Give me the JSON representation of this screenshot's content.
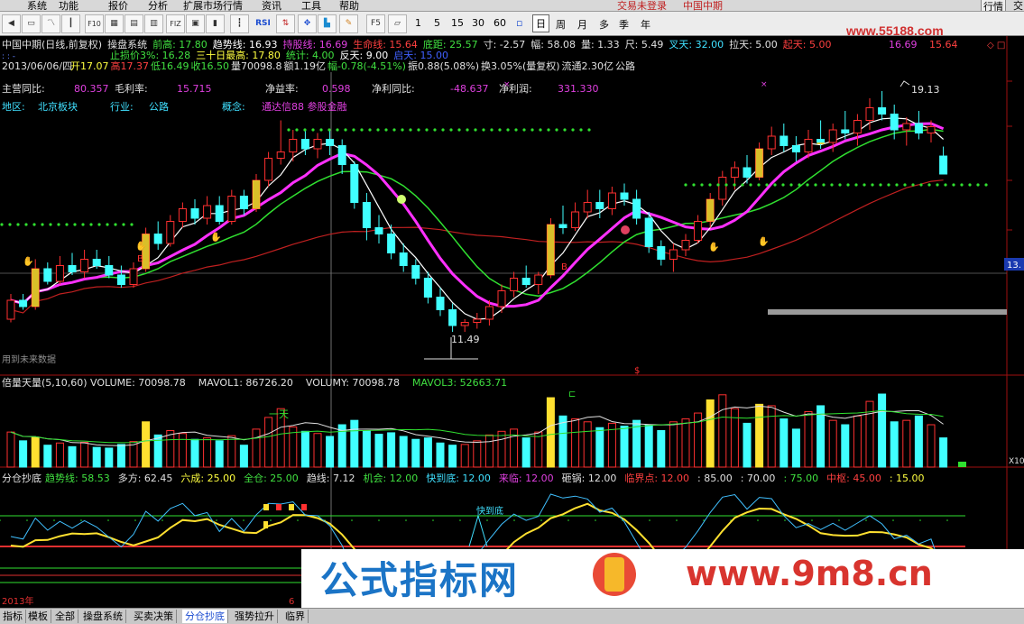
{
  "menu": {
    "items": [
      "系统",
      "功能",
      "报价",
      "分析",
      "扩展市场行情",
      "资讯",
      "工具",
      "帮助"
    ],
    "login_status": "交易未登录",
    "stock_label": "中国中期",
    "right_items": [
      "行情",
      "交"
    ]
  },
  "toolbar": {
    "periods": [
      "1",
      "5",
      "15",
      "30",
      "60"
    ],
    "periods_cn": [
      "日",
      "周",
      "月",
      "多",
      "季",
      "年"
    ],
    "icons": [
      "arrow-left-icon",
      "monitor-icon",
      "line-chart-icon",
      "candle-icon",
      "f10-icon",
      "table-icon",
      "grid-icon",
      "fiz-icon",
      "calc-icon",
      "chart-icon",
      "rsi-icon",
      "arrows-icon",
      "move-icon",
      "bars-icon",
      "pencil-icon",
      "f5-icon",
      "tool-icon"
    ],
    "rsi_label": "RSI",
    "f5_label": "F5",
    "site_banner": "www.55188.com"
  },
  "info": {
    "line1": [
      {
        "t": "中国中期(日线,前复权)",
        "c": "#e0e0e0"
      },
      {
        "t": "操盘系统",
        "c": "#e0e0e0"
      },
      {
        "t": "前高: 17.80",
        "c": "#40e040"
      },
      {
        "t": "趋势线: 16.93",
        "c": "#ffffff"
      },
      {
        "t": "持股线: 16.69",
        "c": "#e040e0"
      },
      {
        "t": "生命线: 15.64",
        "c": "#ff4040"
      },
      {
        "t": "底距: 25.57",
        "c": "#40e040"
      },
      {
        "t": "寸: -2.57",
        "c": "#e0e0e0"
      },
      {
        "t": "幅: 58.08",
        "c": "#e0e0e0"
      },
      {
        "t": "量: 1.33",
        "c": "#e0e0e0"
      },
      {
        "t": "尺: 5.49",
        "c": "#e0e0e0"
      },
      {
        "t": "叉天: 32.00",
        "c": "#40e0ff"
      },
      {
        "t": "拉天: 5.00",
        "c": "#e0e0e0"
      },
      {
        "t": "起天: 5.00",
        "c": "#ff4040"
      }
    ],
    "line1_right": [
      {
        "t": "16.69",
        "c": "#e040e0"
      },
      {
        "t": "15.64",
        "c": "#ff4040"
      }
    ],
    "line2": [
      {
        "t": "止损价3%: 16.28",
        "c": "#40e040"
      },
      {
        "t": "三十日最高: 17.80",
        "c": "#ffff40"
      },
      {
        "t": "统计: 4.00",
        "c": "#40e040"
      },
      {
        "t": "反天: 9.00",
        "c": "#ffffff"
      },
      {
        "t": "启天: 15.00",
        "c": "#4060ff"
      }
    ],
    "line3": "2013/06/06/四",
    "line3_items": [
      {
        "t": "开17.07",
        "c": "#ffff40"
      },
      {
        "t": "高17.37",
        "c": "#ff4040"
      },
      {
        "t": "低16.49",
        "c": "#40e040"
      },
      {
        "t": "收16.50",
        "c": "#40e040"
      },
      {
        "t": "量70098.8",
        "c": "#e0e0e0"
      },
      {
        "t": "额1.19亿",
        "c": "#e0e0e0"
      },
      {
        "t": "幅-0.78(-4.51%)",
        "c": "#40e040"
      },
      {
        "t": "振0.88(5.08%)",
        "c": "#e0e0e0"
      },
      {
        "t": "换3.05%(量复权)",
        "c": "#e0e0e0"
      },
      {
        "t": "流通2.30亿",
        "c": "#e0e0e0"
      },
      {
        "t": "公路",
        "c": "#e0e0e0"
      }
    ]
  },
  "fundamentals": {
    "items": [
      {
        "label": "主营同比:",
        "value": "80.357"
      },
      {
        "label": "毛利率:",
        "value": "15.715"
      },
      {
        "label": "净益率:",
        "value": "0.598"
      },
      {
        "label": "净利同比:",
        "value": "-48.637"
      },
      {
        "label": "净利润:",
        "value": "331.330"
      }
    ],
    "region_label": "地区:",
    "region": "北京板块",
    "industry_label": "行业:",
    "industry": "公路",
    "concept_label": "概念:",
    "concept": "通达信88  参股金融"
  },
  "main_chart": {
    "peak_label": "19.13",
    "low_label": "11.49",
    "right_price": "13.",
    "future_note": "用到未来数据",
    "buy_marker": "B",
    "sell_marker": "$",
    "colors": {
      "up": "#ff3030",
      "down": "#40ffff",
      "white": "#ffffff",
      "magenta": "#ff30ff",
      "green": "#30e030",
      "lifeline": "#c02020",
      "yellow": "#ffe030"
    }
  },
  "volume_panel": {
    "title": "倍量天量(5,10,60)",
    "items": [
      {
        "t": "VOLUME: 70098.78",
        "c": "#e0e0e0"
      },
      {
        "t": "MAVOL1: 86726.20",
        "c": "#e0e0e0"
      },
      {
        "t": "VOLUMY: 70098.78",
        "c": "#e0e0e0"
      },
      {
        "t": "MAVOL3: 52663.71",
        "c": "#40e040"
      }
    ],
    "sky_label": "一天",
    "right_tag": "X10"
  },
  "indicator_panel": {
    "title": "分仓抄底",
    "items": [
      {
        "t": "趋势线: 58.53",
        "c": "#40e040"
      },
      {
        "t": "多方: 62.45",
        "c": "#e0e0e0"
      },
      {
        "t": "六成: 25.00",
        "c": "#ffff40"
      },
      {
        "t": "全仓: 25.00",
        "c": "#40e040"
      },
      {
        "t": "趋线: 7.12",
        "c": "#e0e0e0"
      },
      {
        "t": "机会: 12.00",
        "c": "#40e040"
      },
      {
        "t": "快到底: 12.00",
        "c": "#40e0ff"
      },
      {
        "t": "来临: 12.00",
        "c": "#e040e0"
      },
      {
        "t": "砸锅: 12.00",
        "c": "#e0e0e0"
      },
      {
        "t": "临界点: 12.00",
        "c": "#ff4040"
      },
      {
        "t": ": 85.00",
        "c": "#e0e0e0"
      },
      {
        "t": ": 70.00",
        "c": "#e0e0e0"
      },
      {
        "t": ": 75.00",
        "c": "#40e040"
      },
      {
        "t": "中枢: 45.00",
        "c": "#ff4040"
      },
      {
        "t": ": 15.00",
        "c": "#ffff40"
      }
    ],
    "fast_bottom_label": "快到底",
    "year_label": "2013年",
    "month_label": "6"
  },
  "bottom_tabs": [
    "指标",
    "模板",
    "全部",
    "操盘系统",
    "买卖决策",
    "分仓抄底",
    "强势拉升",
    "临界"
  ],
  "active_tab": "分仓抄底",
  "watermark": {
    "left": "公式指标网",
    "right": "www.9m8.cn"
  },
  "candles": [
    [
      11.9,
      12.7,
      11.8,
      12.5
    ],
    [
      12.5,
      12.7,
      12.2,
      12.3
    ],
    [
      12.3,
      13.8,
      12.2,
      13.5
    ],
    [
      13.5,
      13.7,
      13.0,
      13.1
    ],
    [
      13.1,
      13.9,
      13.0,
      13.6
    ],
    [
      13.6,
      14.0,
      13.3,
      13.4
    ],
    [
      13.4,
      14.1,
      13.2,
      13.8
    ],
    [
      13.8,
      14.1,
      13.5,
      13.6
    ],
    [
      13.6,
      13.9,
      13.2,
      13.3
    ],
    [
      13.3,
      13.6,
      12.9,
      13.0
    ],
    [
      13.0,
      13.7,
      12.9,
      13.5
    ],
    [
      13.5,
      14.8,
      13.4,
      14.6
    ],
    [
      14.6,
      15.0,
      14.1,
      14.3
    ],
    [
      14.3,
      15.2,
      14.2,
      15.0
    ],
    [
      15.0,
      15.6,
      14.8,
      15.4
    ],
    [
      15.4,
      15.7,
      14.9,
      15.1
    ],
    [
      15.1,
      15.8,
      14.9,
      15.5
    ],
    [
      15.5,
      15.8,
      14.9,
      15.0
    ],
    [
      15.0,
      16.0,
      14.9,
      15.8
    ],
    [
      15.8,
      16.0,
      15.2,
      15.4
    ],
    [
      15.4,
      16.5,
      15.3,
      16.3
    ],
    [
      16.3,
      17.2,
      16.1,
      17.0
    ],
    [
      17.0,
      18.2,
      16.8,
      17.2
    ],
    [
      17.2,
      17.9,
      16.9,
      17.6
    ],
    [
      17.6,
      17.9,
      17.1,
      17.3
    ],
    [
      17.3,
      17.8,
      17.0,
      17.6
    ],
    [
      17.6,
      17.9,
      17.1,
      17.4
    ],
    [
      17.4,
      17.6,
      16.5,
      16.8
    ],
    [
      16.8,
      16.9,
      15.4,
      15.6
    ],
    [
      15.6,
      15.9,
      14.4,
      14.8
    ],
    [
      14.8,
      15.2,
      14.3,
      14.6
    ],
    [
      14.6,
      14.9,
      13.8,
      14.0
    ],
    [
      14.0,
      14.3,
      13.4,
      13.6
    ],
    [
      13.6,
      13.8,
      13.0,
      13.2
    ],
    [
      13.2,
      13.4,
      12.4,
      12.6
    ],
    [
      12.6,
      12.9,
      12.0,
      12.2
    ],
    [
      12.2,
      12.4,
      11.5,
      11.7
    ],
    [
      11.7,
      11.9,
      11.5,
      11.8
    ],
    [
      11.8,
      12.1,
      11.6,
      11.9
    ],
    [
      11.9,
      12.5,
      11.7,
      12.3
    ],
    [
      12.3,
      13.0,
      12.1,
      12.8
    ],
    [
      12.8,
      13.4,
      12.6,
      13.2
    ],
    [
      13.2,
      13.6,
      12.9,
      13.0
    ],
    [
      13.0,
      13.4,
      12.7,
      13.3
    ],
    [
      13.3,
      15.1,
      13.2,
      14.9
    ],
    [
      14.9,
      15.5,
      14.6,
      14.8
    ],
    [
      14.8,
      15.6,
      14.7,
      15.3
    ],
    [
      15.3,
      16.0,
      15.1,
      15.6
    ],
    [
      15.6,
      16.0,
      15.1,
      15.4
    ],
    [
      15.4,
      16.1,
      15.2,
      15.9
    ],
    [
      15.9,
      16.2,
      15.5,
      15.7
    ],
    [
      15.7,
      16.0,
      14.9,
      15.1
    ],
    [
      15.1,
      15.3,
      14.0,
      14.2
    ],
    [
      14.2,
      14.4,
      13.6,
      13.8
    ],
    [
      13.8,
      14.3,
      13.4,
      14.1
    ],
    [
      14.1,
      14.6,
      13.9,
      14.4
    ],
    [
      14.4,
      15.2,
      14.3,
      15.0
    ],
    [
      15.0,
      15.9,
      14.8,
      15.7
    ],
    [
      15.7,
      16.6,
      15.5,
      16.4
    ],
    [
      16.4,
      16.9,
      16.0,
      16.7
    ],
    [
      16.7,
      17.1,
      16.2,
      16.4
    ],
    [
      16.4,
      17.5,
      16.3,
      17.3
    ],
    [
      17.3,
      18.0,
      17.1,
      17.7
    ],
    [
      17.7,
      18.1,
      17.2,
      17.4
    ],
    [
      17.4,
      17.7,
      16.9,
      17.2
    ],
    [
      17.2,
      17.9,
      17.0,
      17.6
    ],
    [
      17.6,
      18.2,
      17.3,
      17.5
    ],
    [
      17.5,
      18.1,
      17.2,
      17.9
    ],
    [
      17.9,
      18.5,
      17.6,
      17.8
    ],
    [
      17.8,
      18.4,
      17.4,
      18.2
    ],
    [
      18.2,
      18.9,
      17.9,
      18.6
    ],
    [
      18.6,
      19.13,
      18.2,
      18.4
    ],
    [
      18.4,
      18.7,
      17.6,
      17.9
    ],
    [
      17.9,
      18.3,
      17.4,
      18.1
    ],
    [
      18.1,
      18.5,
      17.6,
      17.8
    ],
    [
      17.8,
      18.2,
      17.5,
      18.0
    ],
    [
      17.07,
      17.37,
      16.49,
      16.5
    ]
  ],
  "volumes": [
    48,
    36,
    41,
    30,
    33,
    28,
    34,
    27,
    26,
    31,
    35,
    62,
    44,
    50,
    46,
    38,
    40,
    36,
    43,
    30,
    52,
    68,
    80,
    55,
    49,
    46,
    42,
    58,
    64,
    50,
    45,
    47,
    42,
    38,
    40,
    33,
    30,
    31,
    36,
    44,
    49,
    52,
    40,
    48,
    95,
    70,
    66,
    62,
    54,
    60,
    56,
    64,
    58,
    50,
    62,
    66,
    74,
    92,
    99,
    80,
    60,
    86,
    84,
    66,
    52,
    76,
    84,
    64,
    58,
    70,
    90,
    100,
    62,
    64,
    70,
    58,
    40
  ]
}
